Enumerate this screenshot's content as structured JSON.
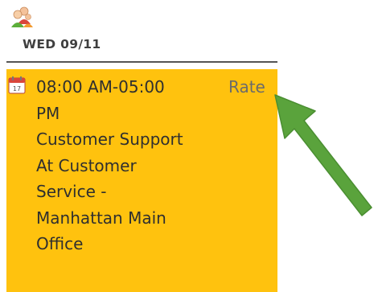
{
  "header": {
    "day_label": "WED 09/11",
    "icon": "users-icon"
  },
  "shift": {
    "icon": "calendar-icon",
    "lines": [
      "08:00 AM-05:00",
      "PM",
      "Customer Support",
      "At Customer",
      "Service -",
      "Manhattan Main",
      "Office"
    ],
    "rate_label": "Rate"
  },
  "colors": {
    "card_background": "#ffc20e",
    "arrow": "#5aa33c",
    "divider": "#555555"
  }
}
